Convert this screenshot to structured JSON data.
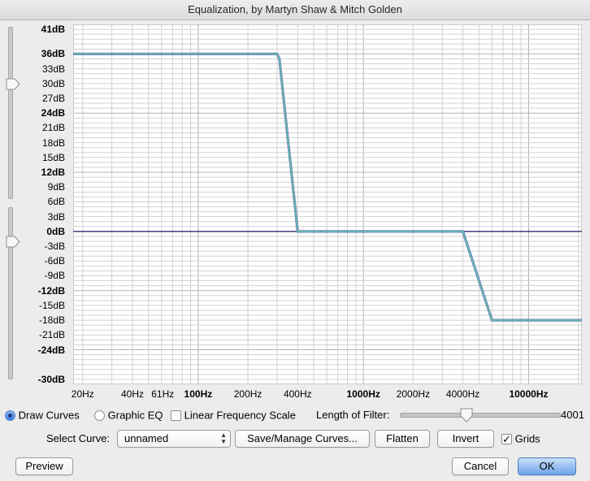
{
  "window": {
    "title": "Equalization, by Martyn Shaw & Mitch Golden"
  },
  "y_axis": {
    "labels": [
      {
        "text": "41dB",
        "db": 41,
        "major": true
      },
      {
        "text": "36dB",
        "db": 36,
        "major": true
      },
      {
        "text": "33dB",
        "db": 33,
        "major": false
      },
      {
        "text": "30dB",
        "db": 30,
        "major": false
      },
      {
        "text": "27dB",
        "db": 27,
        "major": false
      },
      {
        "text": "24dB",
        "db": 24,
        "major": true
      },
      {
        "text": "21dB",
        "db": 21,
        "major": false
      },
      {
        "text": "18dB",
        "db": 18,
        "major": false
      },
      {
        "text": "15dB",
        "db": 15,
        "major": false
      },
      {
        "text": "12dB",
        "db": 12,
        "major": true
      },
      {
        "text": "9dB",
        "db": 9,
        "major": false
      },
      {
        "text": "6dB",
        "db": 6,
        "major": false
      },
      {
        "text": "3dB",
        "db": 3,
        "major": false
      },
      {
        "text": "0dB",
        "db": 0,
        "major": true
      },
      {
        "text": "-3dB",
        "db": -3,
        "major": false
      },
      {
        "text": "-6dB",
        "db": -6,
        "major": false
      },
      {
        "text": "-9dB",
        "db": -9,
        "major": false
      },
      {
        "text": "-12dB",
        "db": -12,
        "major": true
      },
      {
        "text": "-15dB",
        "db": -15,
        "major": false
      },
      {
        "text": "-18dB",
        "db": -18,
        "major": false
      },
      {
        "text": "-21dB",
        "db": -21,
        "major": false
      },
      {
        "text": "-24dB",
        "db": -24,
        "major": true
      },
      {
        "text": "-30dB",
        "db": -30,
        "major": true
      }
    ],
    "range": [
      -31,
      42
    ]
  },
  "x_axis": {
    "labels": [
      {
        "text": "20Hz",
        "hz": 20,
        "major": false
      },
      {
        "text": "40Hz",
        "hz": 40,
        "major": false
      },
      {
        "text": "61Hz",
        "hz": 61,
        "major": false
      },
      {
        "text": "100Hz",
        "hz": 100,
        "major": true
      },
      {
        "text": "200Hz",
        "hz": 200,
        "major": false
      },
      {
        "text": "400Hz",
        "hz": 400,
        "major": false
      },
      {
        "text": "1000Hz",
        "hz": 1000,
        "major": true
      },
      {
        "text": "2000Hz",
        "hz": 2000,
        "major": false
      },
      {
        "text": "4000Hz",
        "hz": 4000,
        "major": false
      },
      {
        "text": "10000Hz",
        "hz": 10000,
        "major": true
      }
    ],
    "range": [
      17.5,
      21000
    ],
    "scale": "log"
  },
  "chart_data": {
    "type": "line",
    "title": "",
    "xlabel": "",
    "ylabel": "",
    "x_scale": "log",
    "grid": true,
    "series": [
      {
        "x": [
          17.5,
          300,
          310,
          400,
          1000,
          4000,
          6000,
          21000
        ],
        "y": [
          36,
          36,
          35,
          0,
          0,
          0,
          -18,
          -18
        ]
      }
    ],
    "reference_lines": [
      {
        "y": 0
      }
    ]
  },
  "colors": {
    "curve": "#5fb8a8",
    "curve_edge": "#7d74c8",
    "zero_line": "#1b1b6a",
    "grid": "#d2d2d2",
    "grid_major": "#b4b4b4",
    "plot_bg": "#ffffff"
  },
  "controls": {
    "draw_curves": "Draw Curves",
    "graphic_eq": "Graphic EQ",
    "linear_scale": "Linear Frequency Scale",
    "filter_length_label": "Length of Filter:",
    "filter_length_value": "4001",
    "filter_length_fraction": 0.42,
    "select_curve_label": "Select Curve:",
    "select_curve_value": "unnamed",
    "save_manage": "Save/Manage Curves...",
    "flatten": "Flatten",
    "invert": "Invert",
    "grids": "Grids",
    "preview": "Preview",
    "cancel": "Cancel",
    "ok": "OK"
  },
  "state": {
    "mode": "draw_curves",
    "linear_scale_checked": false,
    "grids_checked": true,
    "grids_check_glyph": "✓"
  },
  "icons": {
    "slider_thumb": "slider-thumb-icon",
    "select_arrows": "updown-arrows-icon",
    "checkmark": "checkmark-icon"
  }
}
